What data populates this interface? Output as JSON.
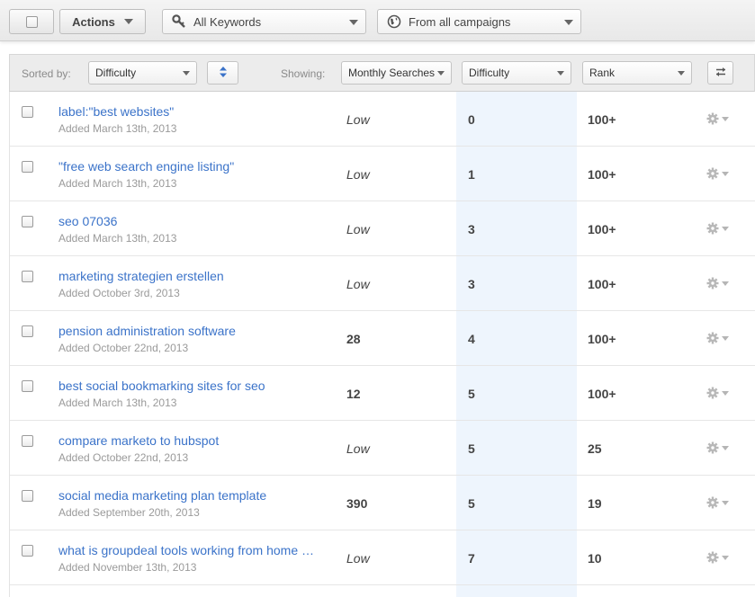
{
  "toolbar": {
    "actions_label": "Actions",
    "keyword_filter": "All Keywords",
    "campaign_filter": "From all campaigns"
  },
  "filters": {
    "sorted_by_label": "Sorted by:",
    "sorted_by_value": "Difficulty",
    "showing_label": "Showing:",
    "column1": "Monthly Searches",
    "column2": "Difficulty",
    "column3": "Rank"
  },
  "rows": [
    {
      "keyword": "label:\"best websites\"",
      "added": "Added March 13th, 2013",
      "searches": "Low",
      "difficulty": "0",
      "rank": "100+"
    },
    {
      "keyword": "\"free web search engine listing\"",
      "added": "Added March 13th, 2013",
      "searches": "Low",
      "difficulty": "1",
      "rank": "100+"
    },
    {
      "keyword": "seo 07036",
      "added": "Added March 13th, 2013",
      "searches": "Low",
      "difficulty": "3",
      "rank": "100+"
    },
    {
      "keyword": "marketing strategien erstellen",
      "added": "Added October 3rd, 2013",
      "searches": "Low",
      "difficulty": "3",
      "rank": "100+"
    },
    {
      "keyword": "pension administration software",
      "added": "Added October 22nd, 2013",
      "searches": "28",
      "difficulty": "4",
      "rank": "100+"
    },
    {
      "keyword": "best social bookmarking sites for seo",
      "added": "Added March 13th, 2013",
      "searches": "12",
      "difficulty": "5",
      "rank": "100+"
    },
    {
      "keyword": "compare marketo to hubspot",
      "added": "Added October 22nd, 2013",
      "searches": "Low",
      "difficulty": "5",
      "rank": "25"
    },
    {
      "keyword": "social media marketing plan template",
      "added": "Added September 20th, 2013",
      "searches": "390",
      "difficulty": "5",
      "rank": "19"
    },
    {
      "keyword": "what is groupdeal tools working from home …",
      "added": "Added November 13th, 2013",
      "searches": "Low",
      "difficulty": "7",
      "rank": "10"
    }
  ],
  "colors": {
    "link": "#3b73c9",
    "difficulty_highlight": "#eef5fd"
  }
}
